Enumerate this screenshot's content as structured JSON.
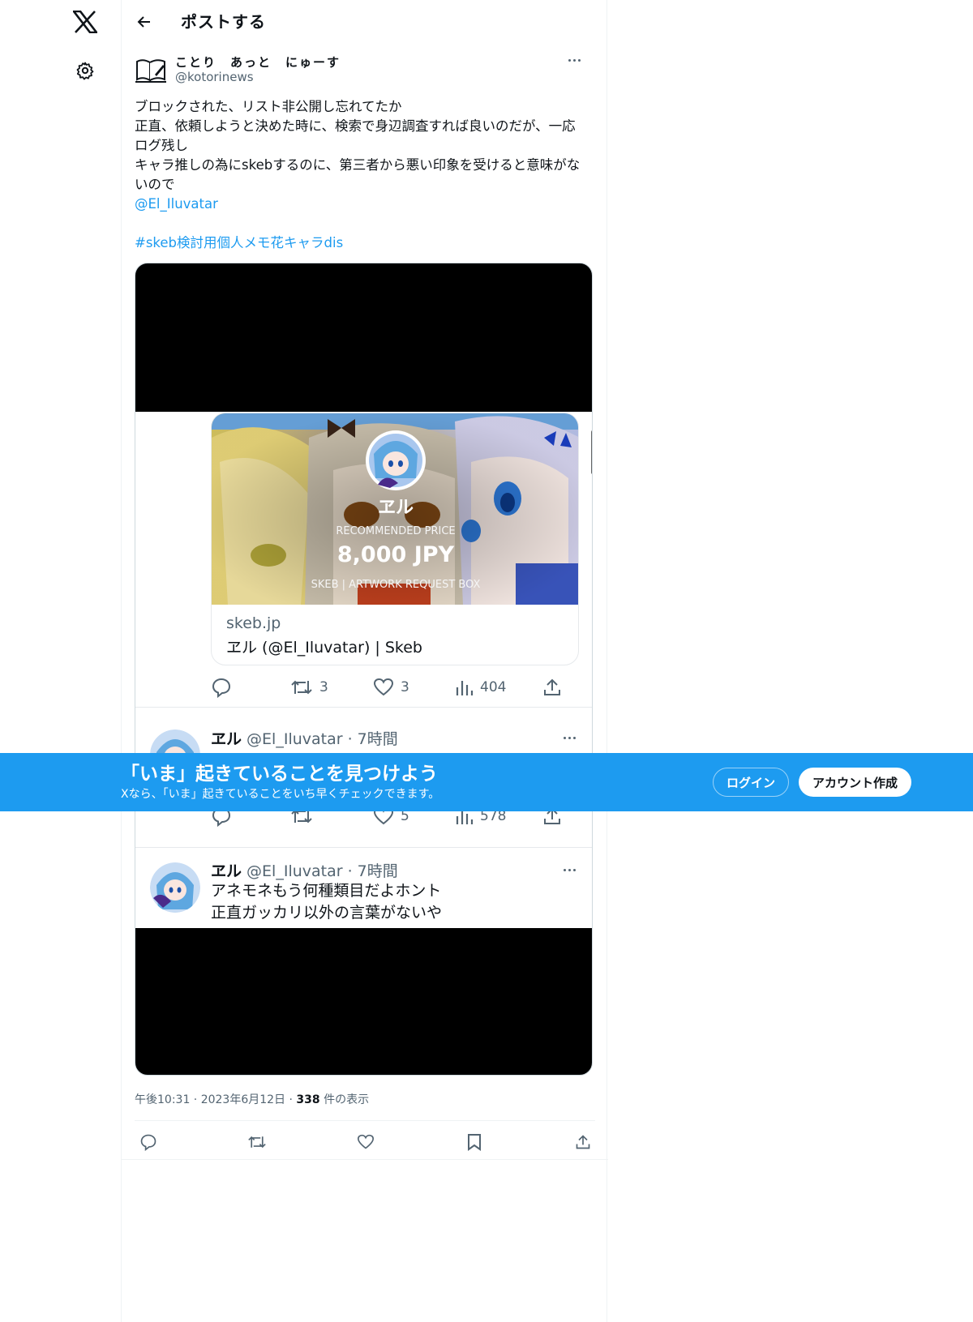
{
  "nav": {
    "logo_icon": "x-logo-icon",
    "settings_icon": "gear-icon"
  },
  "header": {
    "back_icon": "arrow-left-icon",
    "title": "ポストする"
  },
  "post": {
    "author_name": "ことり　あっと　にゅーす",
    "author_handle": "@kotorinews",
    "text_lines": [
      "ブロックされた、リスト非公開し忘れてたか",
      "正直、依頼しようと決めた時に、検索で身辺調査すれば良いのだが、一応",
      "ログ残し",
      "キャラ推しの為にskebするのに、第三者から悪い印象を受けると意味がな",
      "いので"
    ],
    "mention": "@El_Iluvatar",
    "hashtag": "#skeb検討用個人メモ花キャラdis",
    "timestamp": "午後10:31 · 2023年6月12日 · ",
    "views_count": "338",
    "views_label": " 件の表示"
  },
  "screenshot": {
    "card": {
      "overlay_name": "ヱル",
      "overlay_caption": "RECOMMENDED PRICE",
      "overlay_price": "8,000 JPY",
      "overlay_footer": "SKEB | ARTWORK REQUEST BOX",
      "domain": "skeb.jp",
      "title": "ヱル (@El_Iluvatar) | Skeb"
    },
    "tweet1_actions": {
      "retweets": "3",
      "likes": "3",
      "views": "404"
    },
    "reply1": {
      "name": "ヱル",
      "meta": " @El_Iluvatar · 7時間"
    },
    "reply1_actions": {
      "likes": "5",
      "views": "578"
    },
    "reply2": {
      "name": "ヱル",
      "meta": " @El_Iluvatar · 7時間",
      "line1": "アネモネもう何種類目だよホント",
      "line2": "正直ガッカリ以外の言葉がないや"
    }
  },
  "banner": {
    "title": "「いま」起きていることを見つけよう",
    "subtitle": "Xなら、「いま」起きていることをいち早くチェックできます。",
    "login": "ログイン",
    "signup": "アカウント作成"
  },
  "colors": {
    "accent": "#1d9bf0",
    "text": "#0f1419",
    "muted": "#536471"
  }
}
